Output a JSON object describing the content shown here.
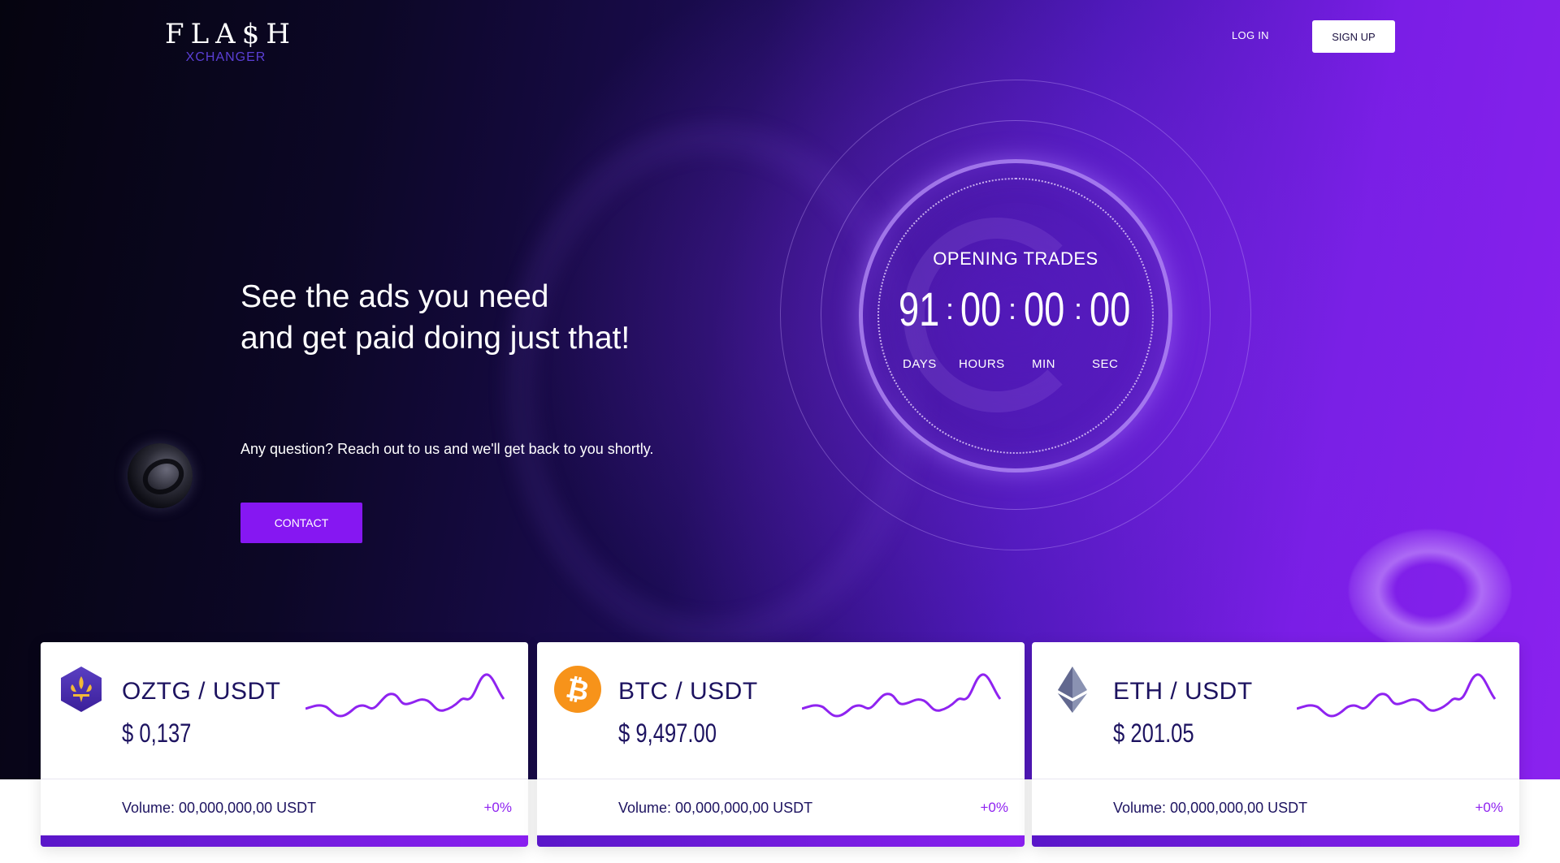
{
  "brand": {
    "name": "FLA$H",
    "sub": "XCHANGER",
    "accent": "#8617f2"
  },
  "nav": {
    "login_label": "LOG IN",
    "signup_label": "SIGN UP"
  },
  "hero": {
    "headline_line1": "See the ads you need",
    "headline_line2": "and get paid doing just that!",
    "subtext": "Any question? Reach out to us and we'll get back to you shortly.",
    "contact_label": "CONTACT"
  },
  "countdown": {
    "title": "OPENING TRADES",
    "days": "91",
    "hours": "00",
    "min": "00",
    "sec": "00",
    "separator": ":",
    "labels": {
      "days": "DAYS",
      "hours": "HOURS",
      "min": "MIN",
      "sec": "SEC"
    }
  },
  "cards": [
    {
      "pair": "OZTG / USDT",
      "price": "$ 0,137",
      "volume": "Volume: 00,000,000,00 USDT",
      "change": "+0%",
      "icon": "oztg-icon"
    },
    {
      "pair": "BTC / USDT",
      "price": "$ 9,497.00",
      "volume": "Volume: 00,000,000,00 USDT",
      "change": "+0%",
      "icon": "bitcoin-icon"
    },
    {
      "pair": "ETH / USDT",
      "price": "$ 201.05",
      "volume": "Volume: 00,000,000,00 USDT",
      "change": "+0%",
      "icon": "ethereum-icon"
    }
  ]
}
